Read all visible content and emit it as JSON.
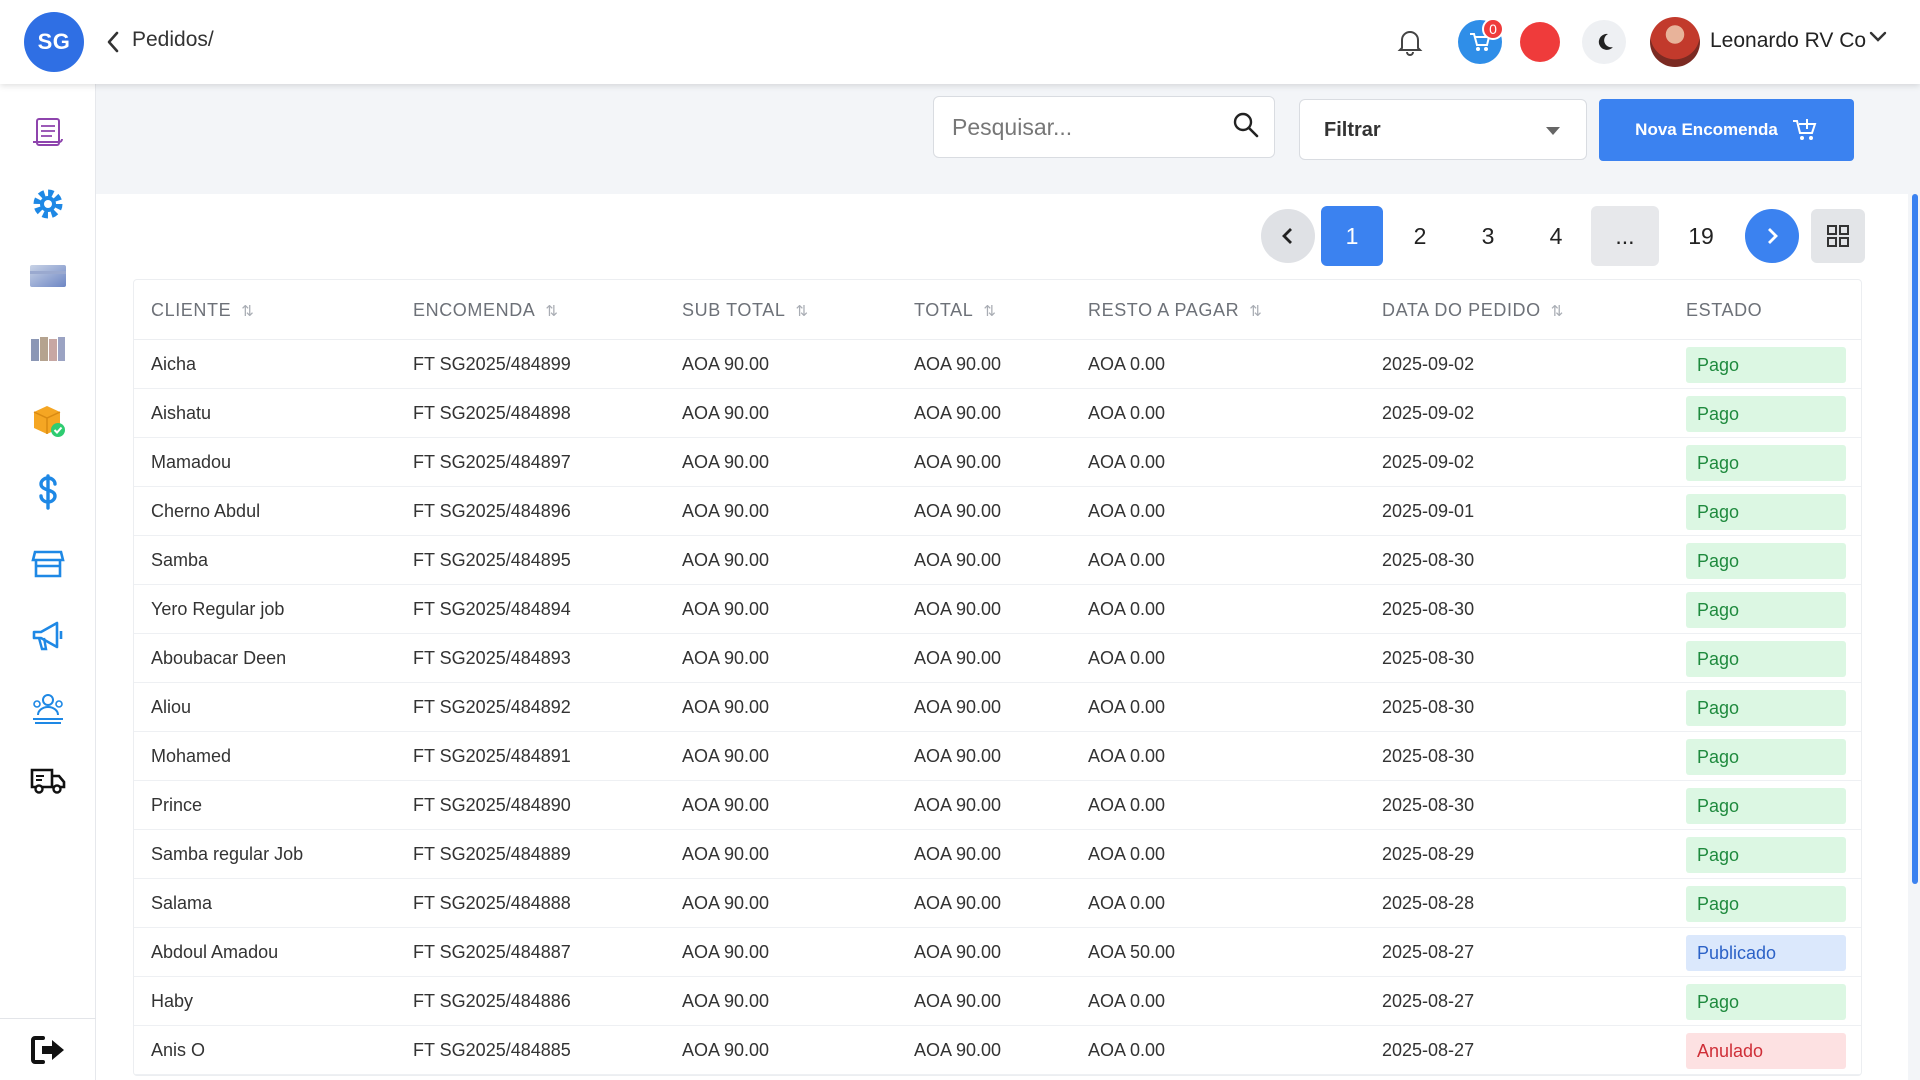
{
  "app": {
    "logo_text": "SG",
    "breadcrumb": "Pedidos/"
  },
  "header": {
    "notification_count": "0",
    "user_name": "Leonardo RV Co"
  },
  "toolbar": {
    "search_placeholder": "Pesquisar...",
    "filter_label": "Filtrar",
    "new_order_label": "Nova Encomenda"
  },
  "pagination": {
    "pages": [
      "1",
      "2",
      "3",
      "4"
    ],
    "ellipsis": "...",
    "last": "19",
    "current": "1"
  },
  "table": {
    "columns": [
      "CLIENTE",
      "ENCOMENDA",
      "SUB TOTAL",
      "TOTAL",
      "RESTO A PAGAR",
      "DATA DO PEDIDO",
      "ESTADO"
    ],
    "rows": [
      {
        "cliente": "Aicha",
        "encomenda": "FT SG2025/484899",
        "sub_total": "AOA 90.00",
        "total": "AOA 90.00",
        "resto": "AOA 0.00",
        "data": "2025-09-02",
        "estado": "Pago"
      },
      {
        "cliente": "Aishatu",
        "encomenda": "FT SG2025/484898",
        "sub_total": "AOA 90.00",
        "total": "AOA 90.00",
        "resto": "AOA 0.00",
        "data": "2025-09-02",
        "estado": "Pago"
      },
      {
        "cliente": "Mamadou",
        "encomenda": "FT SG2025/484897",
        "sub_total": "AOA 90.00",
        "total": "AOA 90.00",
        "resto": "AOA 0.00",
        "data": "2025-09-02",
        "estado": "Pago"
      },
      {
        "cliente": "Cherno Abdul",
        "encomenda": "FT SG2025/484896",
        "sub_total": "AOA 90.00",
        "total": "AOA 90.00",
        "resto": "AOA 0.00",
        "data": "2025-09-01",
        "estado": "Pago"
      },
      {
        "cliente": "Samba",
        "encomenda": "FT SG2025/484895",
        "sub_total": "AOA 90.00",
        "total": "AOA 90.00",
        "resto": "AOA 0.00",
        "data": "2025-08-30",
        "estado": "Pago"
      },
      {
        "cliente": "Yero Regular job",
        "encomenda": "FT SG2025/484894",
        "sub_total": "AOA 90.00",
        "total": "AOA 90.00",
        "resto": "AOA 0.00",
        "data": "2025-08-30",
        "estado": "Pago"
      },
      {
        "cliente": "Aboubacar Deen",
        "encomenda": "FT SG2025/484893",
        "sub_total": "AOA 90.00",
        "total": "AOA 90.00",
        "resto": "AOA 0.00",
        "data": "2025-08-30",
        "estado": "Pago"
      },
      {
        "cliente": "Aliou",
        "encomenda": "FT SG2025/484892",
        "sub_total": "AOA 90.00",
        "total": "AOA 90.00",
        "resto": "AOA 0.00",
        "data": "2025-08-30",
        "estado": "Pago"
      },
      {
        "cliente": "Mohamed",
        "encomenda": "FT SG2025/484891",
        "sub_total": "AOA 90.00",
        "total": "AOA 90.00",
        "resto": "AOA 0.00",
        "data": "2025-08-30",
        "estado": "Pago"
      },
      {
        "cliente": "Prince",
        "encomenda": "FT SG2025/484890",
        "sub_total": "AOA 90.00",
        "total": "AOA 90.00",
        "resto": "AOA 0.00",
        "data": "2025-08-30",
        "estado": "Pago"
      },
      {
        "cliente": "Samba regular Job",
        "encomenda": "FT SG2025/484889",
        "sub_total": "AOA 90.00",
        "total": "AOA 90.00",
        "resto": "AOA 0.00",
        "data": "2025-08-29",
        "estado": "Pago"
      },
      {
        "cliente": "Salama",
        "encomenda": "FT SG2025/484888",
        "sub_total": "AOA 90.00",
        "total": "AOA 90.00",
        "resto": "AOA 0.00",
        "data": "2025-08-28",
        "estado": "Pago"
      },
      {
        "cliente": "Abdoul Amadou",
        "encomenda": "FT SG2025/484887",
        "sub_total": "AOA 90.00",
        "total": "AOA 90.00",
        "resto": "AOA 50.00",
        "data": "2025-08-27",
        "estado": "Publicado"
      },
      {
        "cliente": "Haby",
        "encomenda": "FT SG2025/484886",
        "sub_total": "AOA 90.00",
        "total": "AOA 90.00",
        "resto": "AOA 0.00",
        "data": "2025-08-27",
        "estado": "Pago"
      },
      {
        "cliente": "Anis O",
        "encomenda": "FT SG2025/484885",
        "sub_total": "AOA 90.00",
        "total": "AOA 90.00",
        "resto": "AOA 0.00",
        "data": "2025-08-27",
        "estado": "Anulado"
      }
    ]
  },
  "sidebar": {
    "items": [
      {
        "icon": "scroll-icon"
      },
      {
        "icon": "gear-icon"
      },
      {
        "icon": "card-icon"
      },
      {
        "icon": "books-icon"
      },
      {
        "icon": "box-check-icon"
      },
      {
        "icon": "dollar-icon"
      },
      {
        "icon": "store-icon"
      },
      {
        "icon": "megaphone-icon"
      },
      {
        "icon": "team-icon"
      },
      {
        "icon": "truck-icon"
      }
    ],
    "logout_icon": "logout-icon"
  },
  "colors": {
    "accent": "#3b82f0",
    "pago_bg": "#dcf7e3",
    "pago_fg": "#1f8a3e",
    "publicado_bg": "#dbe8fc",
    "anulado_bg": "#fde1e2"
  }
}
